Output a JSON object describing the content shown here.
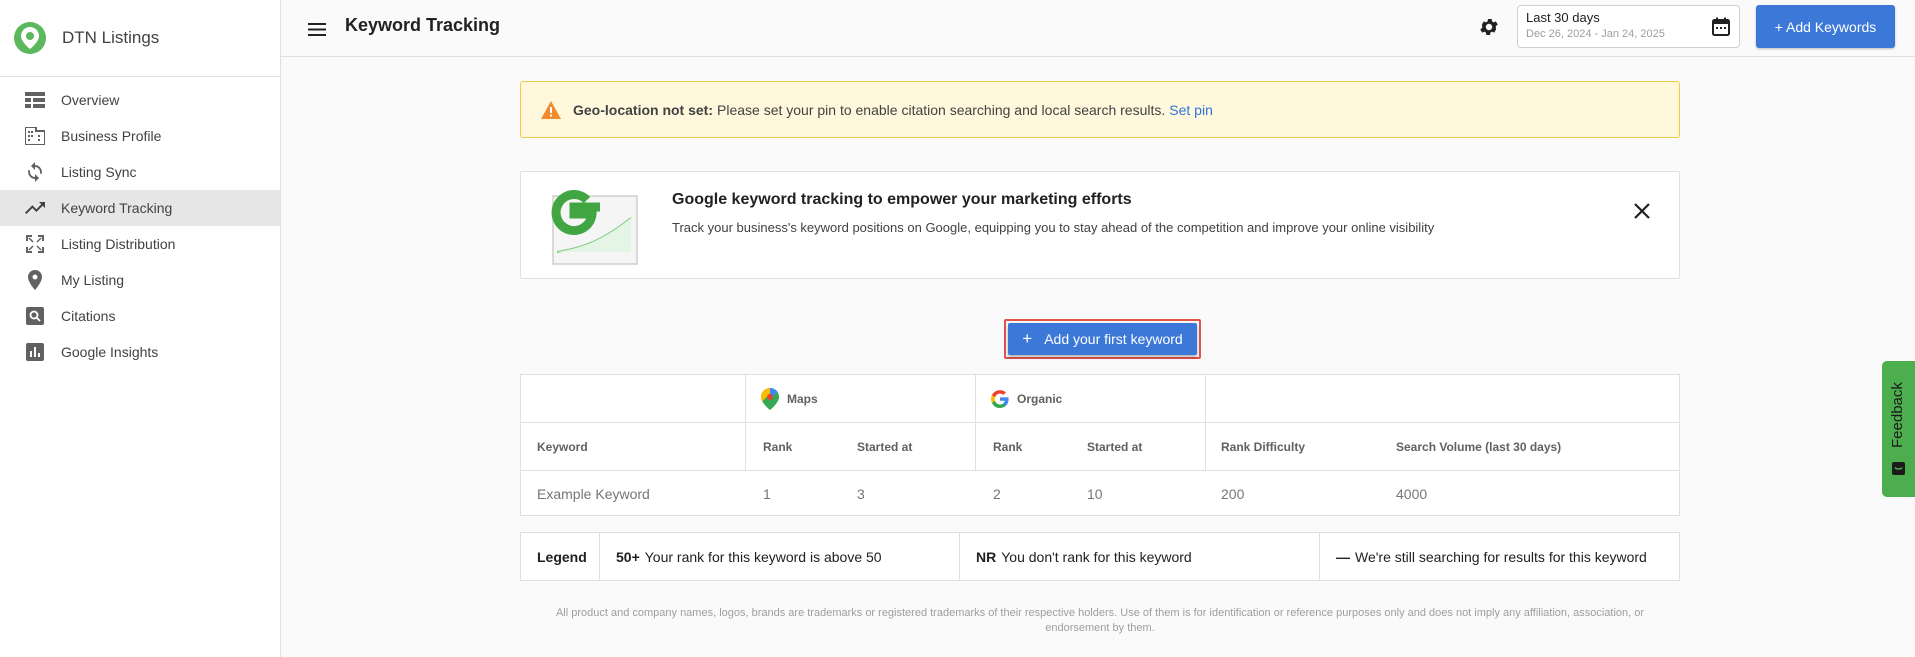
{
  "brand": {
    "name": "DTN Listings",
    "color": "#5cb85c"
  },
  "sidebar": {
    "items": [
      {
        "label": "Overview",
        "icon": "overview-icon",
        "active": false
      },
      {
        "label": "Business Profile",
        "icon": "business-icon",
        "active": false
      },
      {
        "label": "Listing Sync",
        "icon": "sync-icon",
        "active": false
      },
      {
        "label": "Keyword Tracking",
        "icon": "trending-up-icon",
        "active": true
      },
      {
        "label": "Listing Distribution",
        "icon": "expand-icon",
        "active": false
      },
      {
        "label": "My Listing",
        "icon": "pin-icon",
        "active": false
      },
      {
        "label": "Citations",
        "icon": "search-box-icon",
        "active": false
      },
      {
        "label": "Google Insights",
        "icon": "bar-chart-icon",
        "active": false
      }
    ]
  },
  "header": {
    "title": "Keyword Tracking",
    "date_range": "Last 30 days",
    "date_sub": "Dec 26, 2024 - Jan 24, 2025",
    "add_keywords_label": "+ Add Keywords",
    "accent": "#3b78d8"
  },
  "alert": {
    "bold": "Geo-location not set:",
    "text": "Please set your pin to enable citation searching and local search results.",
    "link": "Set pin"
  },
  "promo": {
    "title": "Google keyword tracking to empower your marketing efforts",
    "description": "Track your business's keyword positions on Google, equipping you to stay ahead of the competition and improve your online visibility"
  },
  "first_keyword_button": "Add your first keyword",
  "table": {
    "groups": {
      "maps": "Maps",
      "organic": "Organic"
    },
    "headers": {
      "keyword": "Keyword",
      "maps_rank": "Rank",
      "maps_started": "Started at",
      "organic_rank": "Rank",
      "organic_started": "Started at",
      "difficulty": "Rank Difficulty",
      "volume": "Search Volume (last 30 days)"
    },
    "row": {
      "keyword": "Example Keyword",
      "maps_rank": "1",
      "maps_started": "3",
      "organic_rank": "2",
      "organic_started": "10",
      "difficulty": "200",
      "volume": "4000"
    }
  },
  "legend": {
    "title": "Legend",
    "items": [
      {
        "key": "50+",
        "text": "Your rank for this keyword is above 50"
      },
      {
        "key": "NR",
        "text": "You don't rank for this keyword"
      },
      {
        "key": "—",
        "text": "We're still searching for results for this keyword"
      }
    ]
  },
  "footer": "All product and company names, logos, brands are trademarks or registered trademarks of their respective holders. Use of them is for identification or reference purposes only and does not imply any affiliation, association, or endorsement by them.",
  "feedback": {
    "label": "Feedback",
    "color": "#4cae4c"
  }
}
